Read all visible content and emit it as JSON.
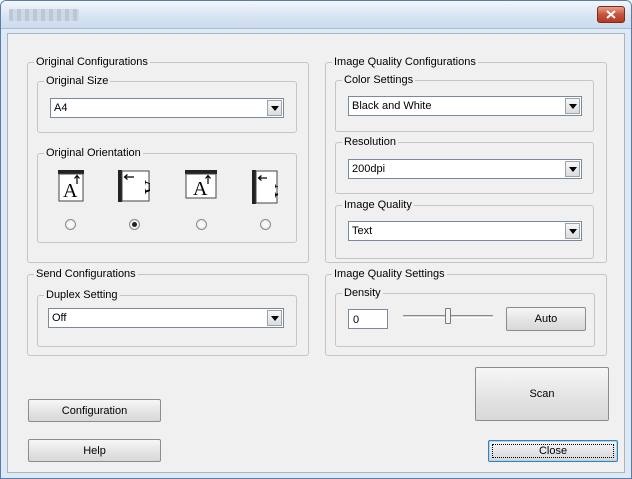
{
  "window": {
    "close_icon": "close-icon"
  },
  "original_config": {
    "legend": "Original Configurations",
    "size": {
      "legend": "Original Size",
      "value": "A4"
    },
    "orientation": {
      "legend": "Original Orientation",
      "options": [
        {
          "name": "portrait-upright",
          "selected": false
        },
        {
          "name": "landscape-left",
          "selected": true
        },
        {
          "name": "portrait-upright-wide",
          "selected": false
        },
        {
          "name": "landscape-right",
          "selected": false
        }
      ]
    }
  },
  "image_quality_config": {
    "legend": "Image Quality Configurations",
    "color": {
      "legend": "Color Settings",
      "value": "Black and White"
    },
    "resolution": {
      "legend": "Resolution",
      "value": "200dpi"
    },
    "quality": {
      "legend": "Image Quality",
      "value": "Text"
    }
  },
  "send_config": {
    "legend": "Send Configurations",
    "duplex": {
      "legend": "Duplex Setting",
      "value": "Off"
    }
  },
  "image_quality_settings": {
    "legend": "Image Quality Settings",
    "density": {
      "legend": "Density",
      "value": "0",
      "slider_fraction": 0.5,
      "auto_label": "Auto"
    }
  },
  "buttons": {
    "scan": "Scan",
    "configuration": "Configuration",
    "help": "Help",
    "close": "Close"
  }
}
